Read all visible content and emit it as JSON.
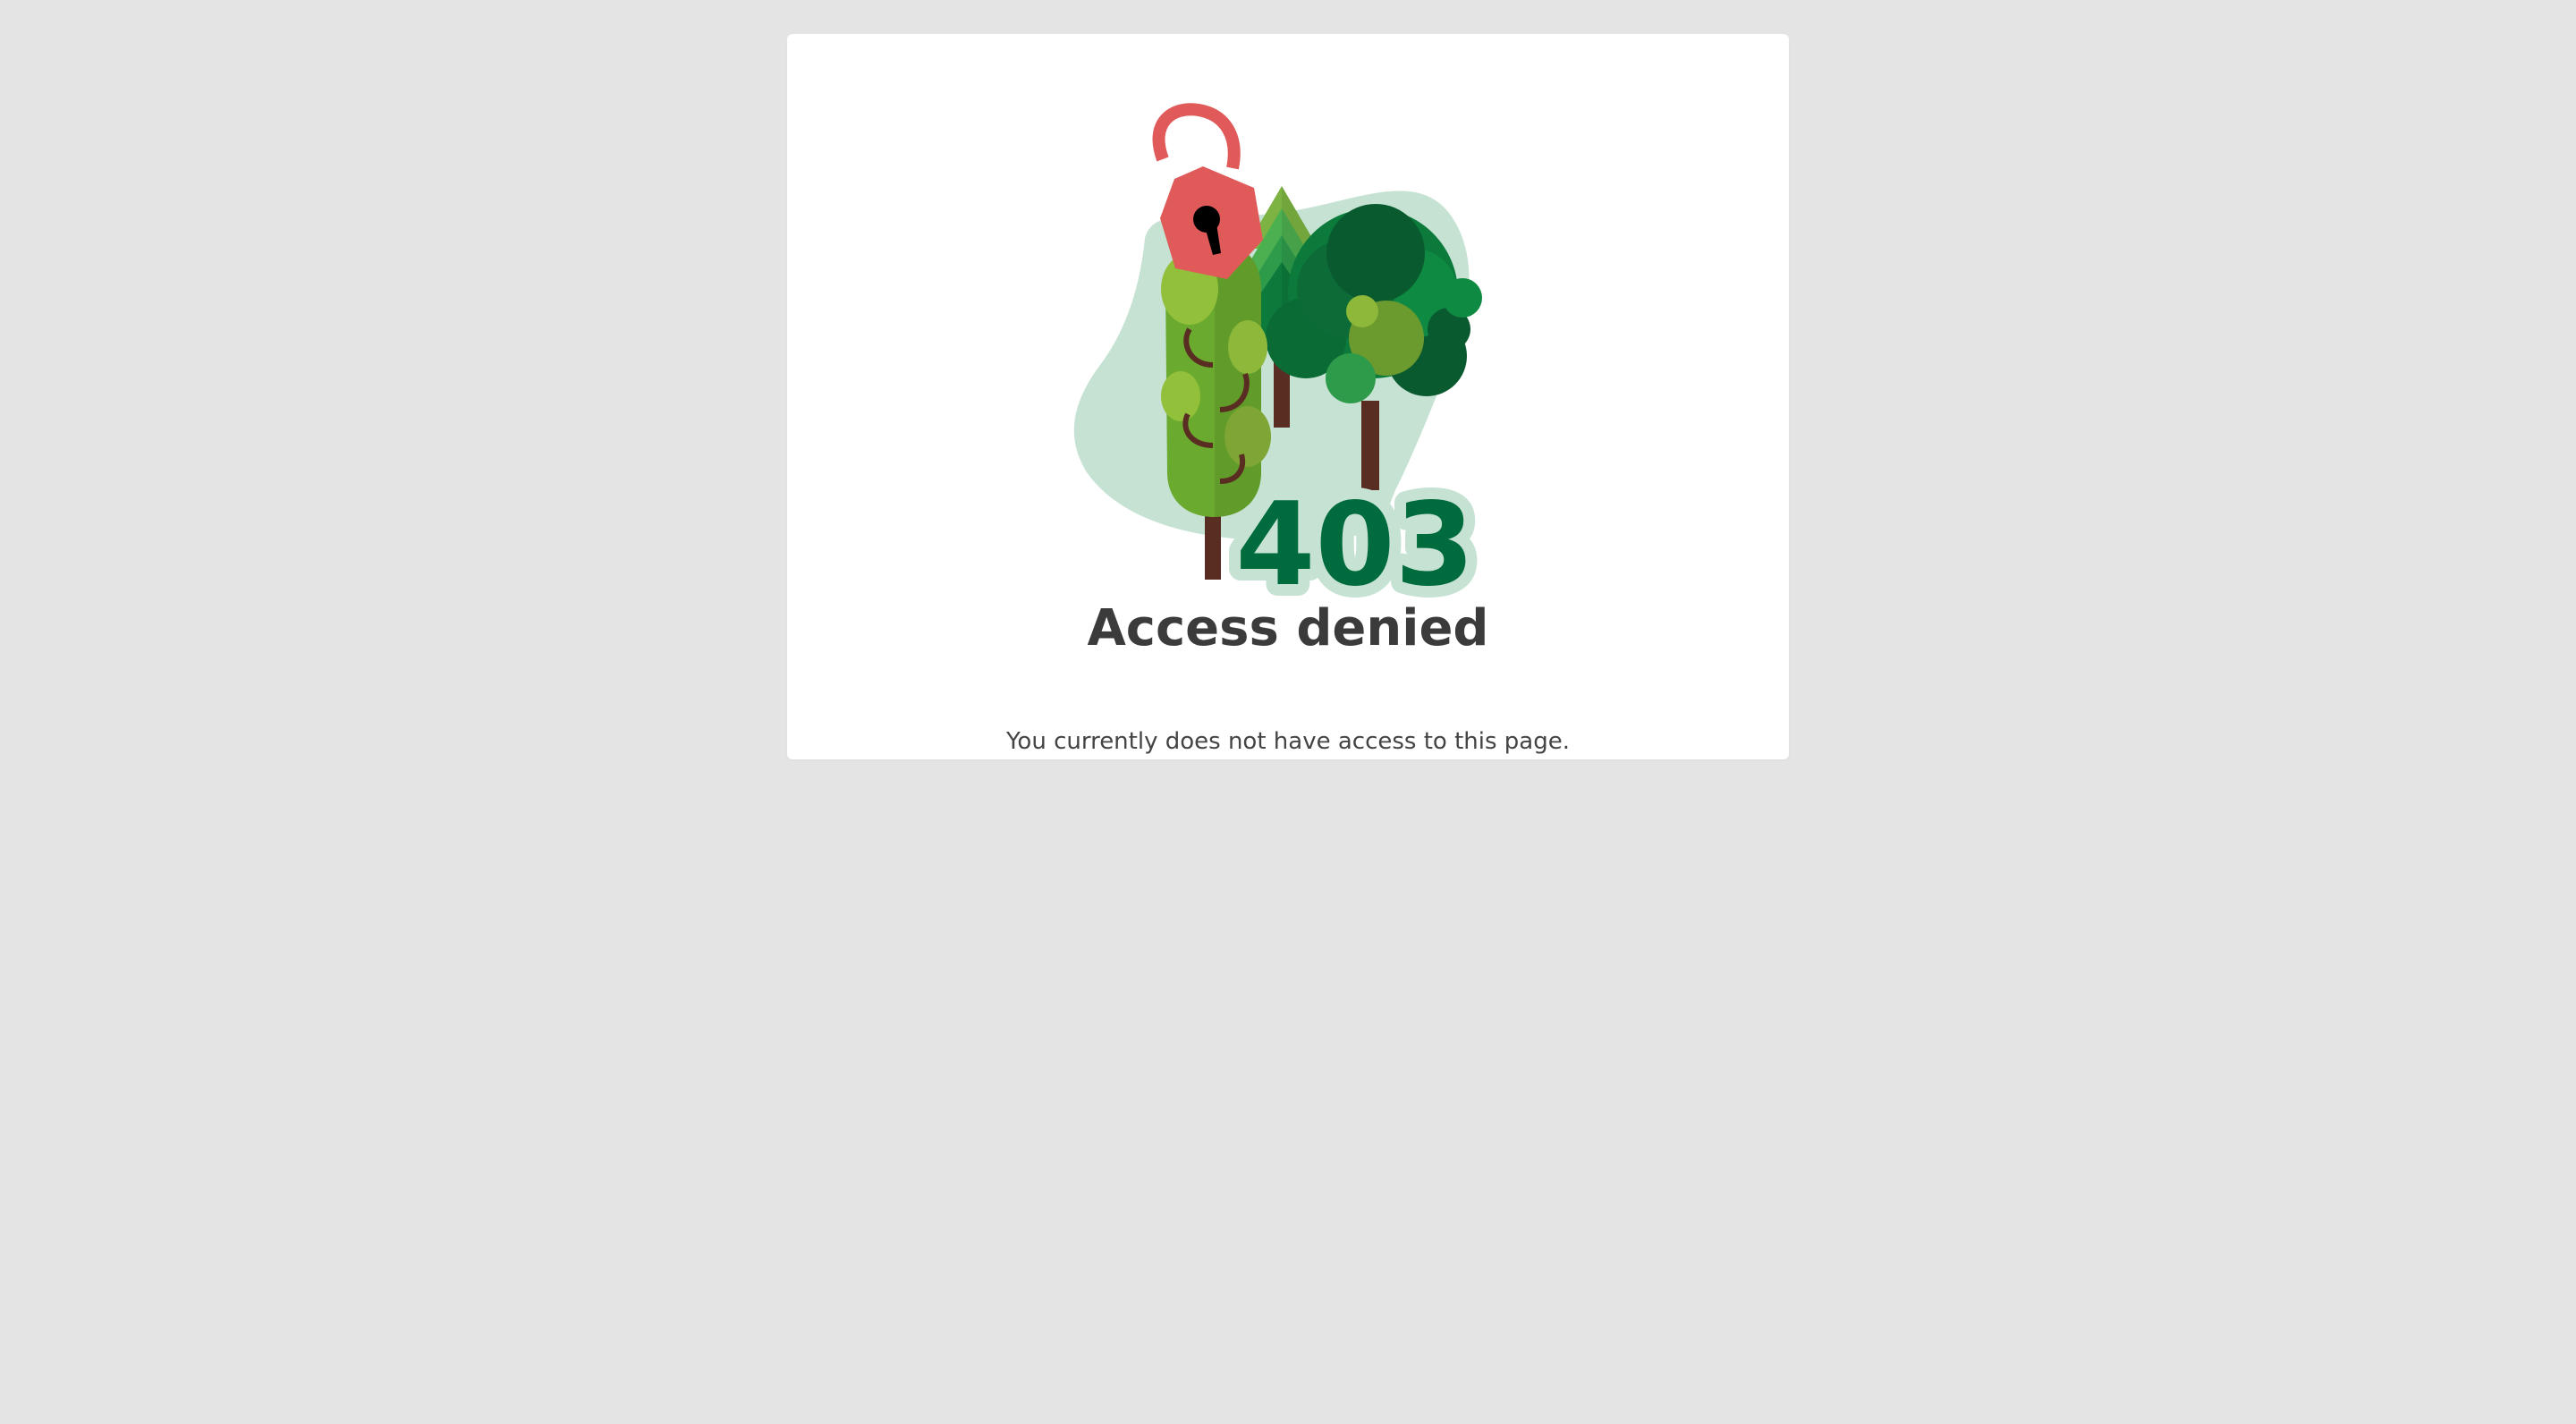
{
  "error_card": {
    "code": "403",
    "title": "Access denied",
    "message": "You currently does not have access to this page.",
    "illustration": {
      "icons": [
        "unlocked-padlock-icon",
        "tree-icon",
        "pine-tree-icon"
      ],
      "colors": {
        "padlock": "#e05a5a",
        "blob": "#c5e2d3",
        "code_text": "#006b3c"
      }
    }
  }
}
